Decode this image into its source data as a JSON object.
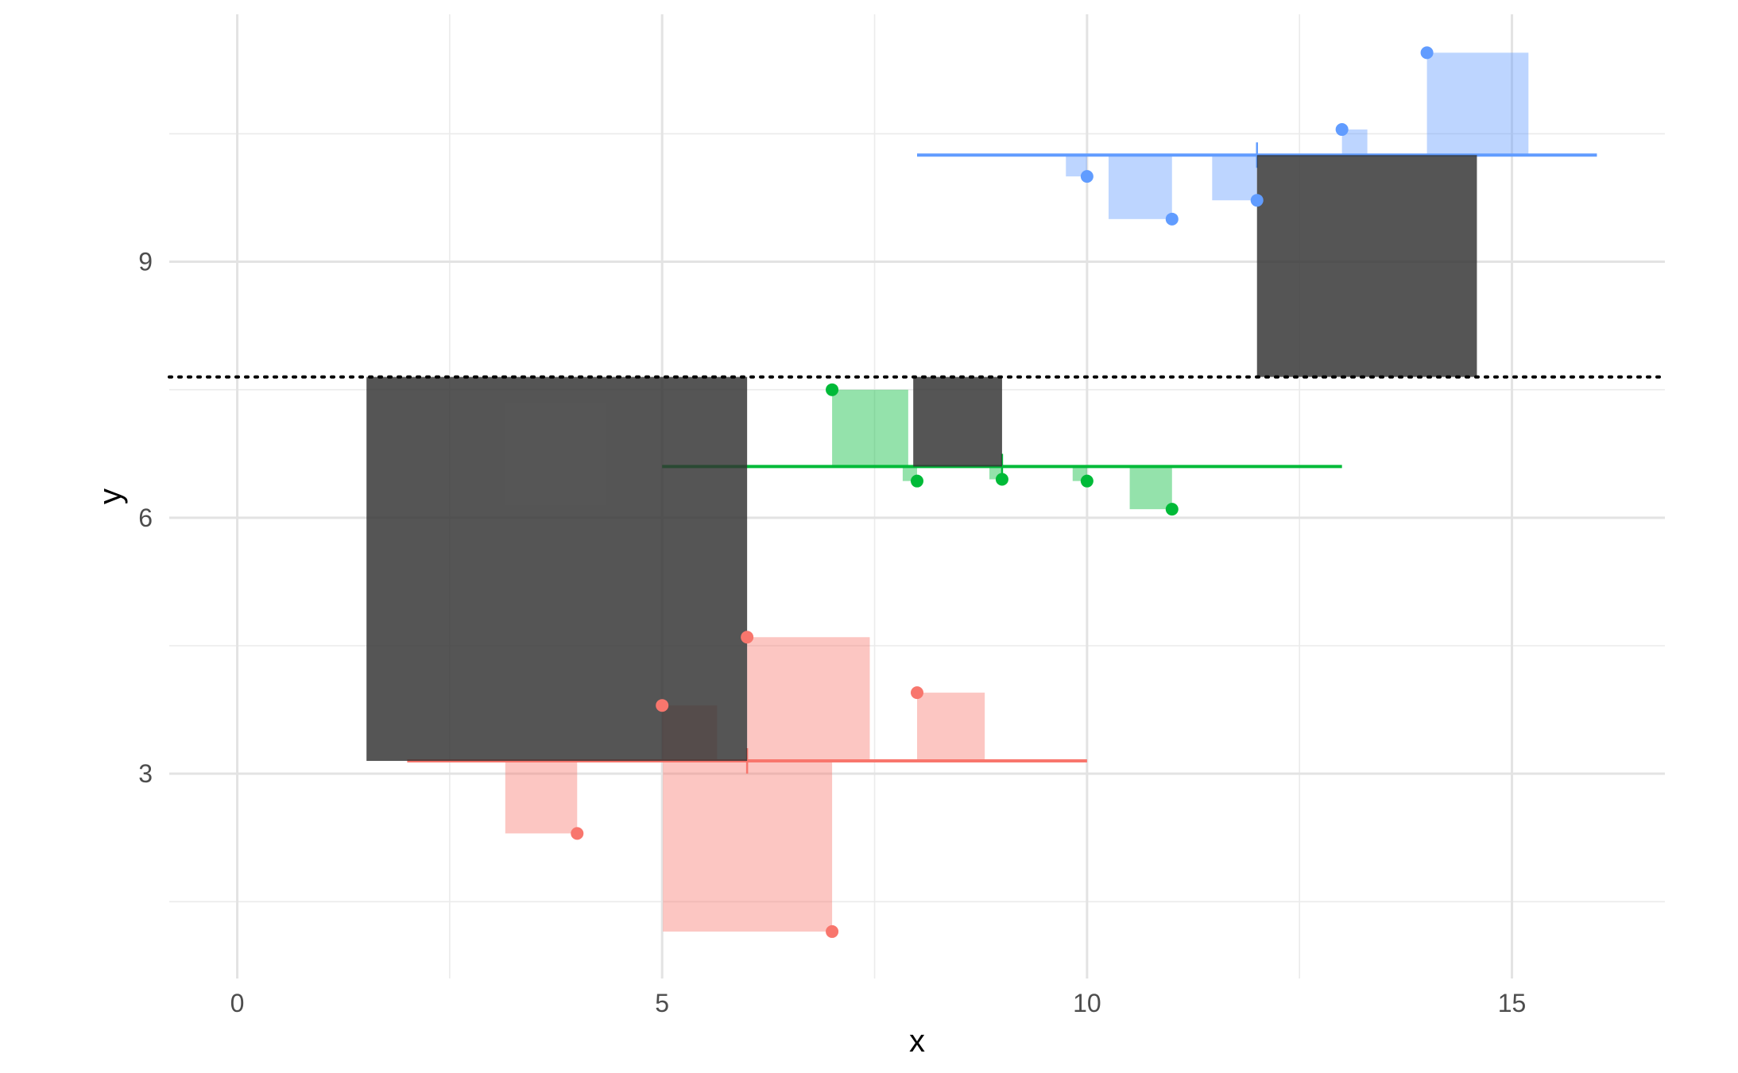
{
  "chart_data": {
    "type": "scatter",
    "xlabel": "x",
    "ylabel": "y",
    "xlim": [
      -0.8,
      16.8
    ],
    "ylim": [
      0.6,
      11.9
    ],
    "x_ticks": [
      0,
      5,
      10,
      15
    ],
    "x_tick_labels": [
      "0",
      "5",
      "10",
      "15"
    ],
    "y_ticks": [
      3,
      6,
      9
    ],
    "y_tick_labels": [
      "3",
      "6",
      "9"
    ],
    "x_minor_ticks": [
      2.5,
      7.5,
      12.5
    ],
    "y_minor_ticks": [
      1.5,
      4.5,
      7.5,
      10.5
    ],
    "grid": true,
    "legend": "none",
    "overall_mean": 7.65,
    "series": [
      {
        "group": "1",
        "color": "#F8766D",
        "mean": 3.15,
        "mean_x_range": [
          2,
          10
        ],
        "mean_tick_x": 6,
        "points": [
          {
            "x": 4,
            "y": 2.3
          },
          {
            "x": 5,
            "y": 3.8
          },
          {
            "x": 6,
            "y": 4.6
          },
          {
            "x": 7,
            "y": 1.15
          },
          {
            "x": 8,
            "y": 3.95
          }
        ]
      },
      {
        "group": "2",
        "color": "#00BA38",
        "mean": 6.6,
        "mean_x_range": [
          5,
          13
        ],
        "mean_tick_x": 9,
        "points": [
          {
            "x": 7,
            "y": 7.5
          },
          {
            "x": 8,
            "y": 6.43
          },
          {
            "x": 9,
            "y": 6.45
          },
          {
            "x": 10,
            "y": 6.43
          },
          {
            "x": 11,
            "y": 6.1
          }
        ]
      },
      {
        "group": "3",
        "color": "#619CFF",
        "mean": 10.25,
        "mean_x_range": [
          8,
          16
        ],
        "mean_tick_x": 12,
        "points": [
          {
            "x": 10,
            "y": 10.0
          },
          {
            "x": 11,
            "y": 9.5
          },
          {
            "x": 12,
            "y": 9.72
          },
          {
            "x": 13,
            "y": 10.55
          },
          {
            "x": 14,
            "y": 11.45
          }
        ]
      }
    ]
  }
}
